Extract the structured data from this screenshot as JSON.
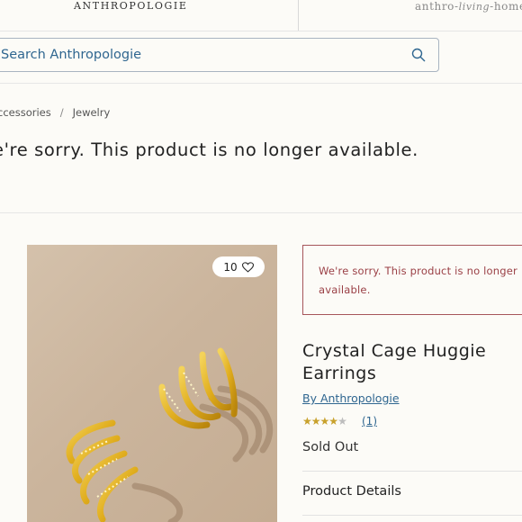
{
  "header": {
    "brand": "ANTHROPOLOGIE",
    "living_prefix": "anthro",
    "living_script": "living",
    "living_suffix": "home"
  },
  "search": {
    "placeholder": "Search Anthropologie",
    "value": ""
  },
  "breadcrumb": {
    "items": [
      "ccessories",
      "Jewelry"
    ],
    "separator": "/"
  },
  "notice": {
    "heading": "e're sorry. This product is no longer available."
  },
  "product": {
    "favorite_count": "10",
    "alert": "We're sorry. This product is no longer available.",
    "title": "Crystal Cage Huggie Earrings",
    "brand_link": "By Anthropologie",
    "rating": 4,
    "rating_max": 5,
    "review_count": "(1)",
    "status": "Sold Out",
    "details_heading": "Product Details"
  },
  "colors": {
    "link": "#2f6690",
    "alert_border": "#a6555a",
    "alert_text": "#9a3f45",
    "star": "#c8a12c"
  }
}
